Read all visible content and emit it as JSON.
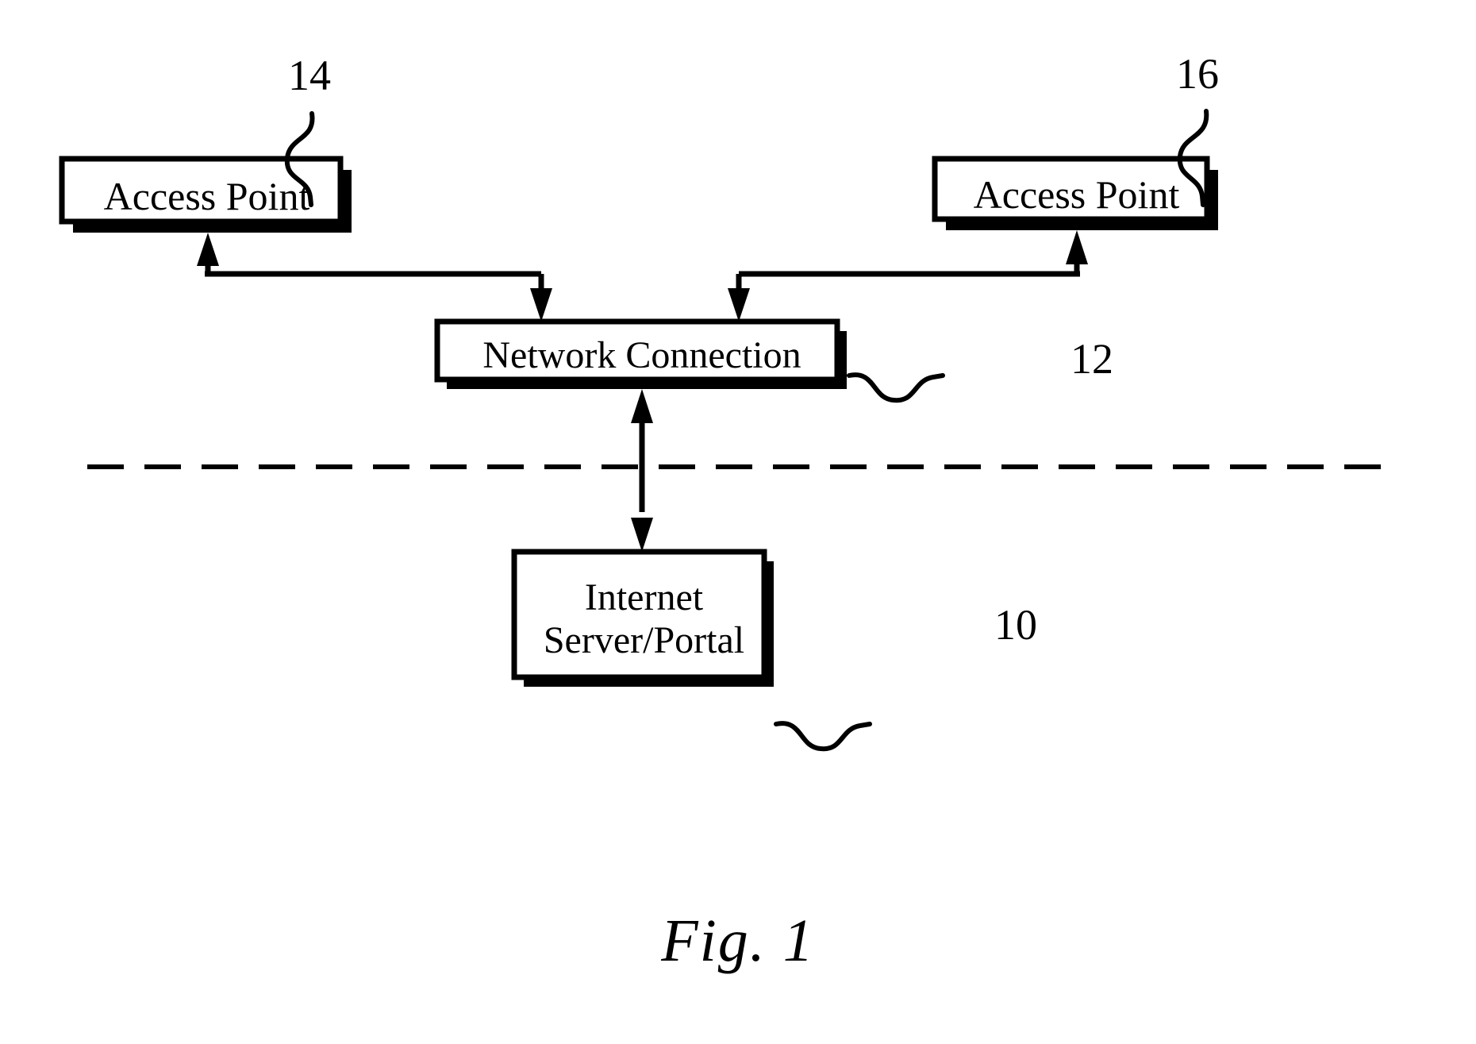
{
  "figure": {
    "caption": "Fig. 1",
    "kind": "patent-block-diagram"
  },
  "nodes": {
    "access_point_left": {
      "label": "Access Point",
      "ref": "14"
    },
    "access_point_right": {
      "label": "Access Point",
      "ref": "16"
    },
    "network_connection": {
      "label": "Network Connection",
      "ref": "12"
    },
    "internet_server_portal": {
      "label": "Internet\nServer/Portal",
      "ref": "10"
    }
  },
  "connectors": [
    {
      "name": "network-connection-to-access-point-left",
      "from": "network_connection",
      "to": "access_point_left",
      "style": "elbow",
      "arrowheads": "both-ends-separate"
    },
    {
      "name": "network-connection-to-access-point-right",
      "from": "network_connection",
      "to": "access_point_right",
      "style": "elbow",
      "arrowheads": "both-ends-separate"
    },
    {
      "name": "network-connection-to-internet-server",
      "from": "network_connection",
      "to": "internet_server_portal",
      "style": "straight-vertical",
      "arrowheads": "double"
    }
  ],
  "divider": {
    "name": "boundary-dashed-line",
    "style": "dash-dot"
  },
  "colors": {
    "ink": "#000000",
    "background": "#ffffff"
  }
}
